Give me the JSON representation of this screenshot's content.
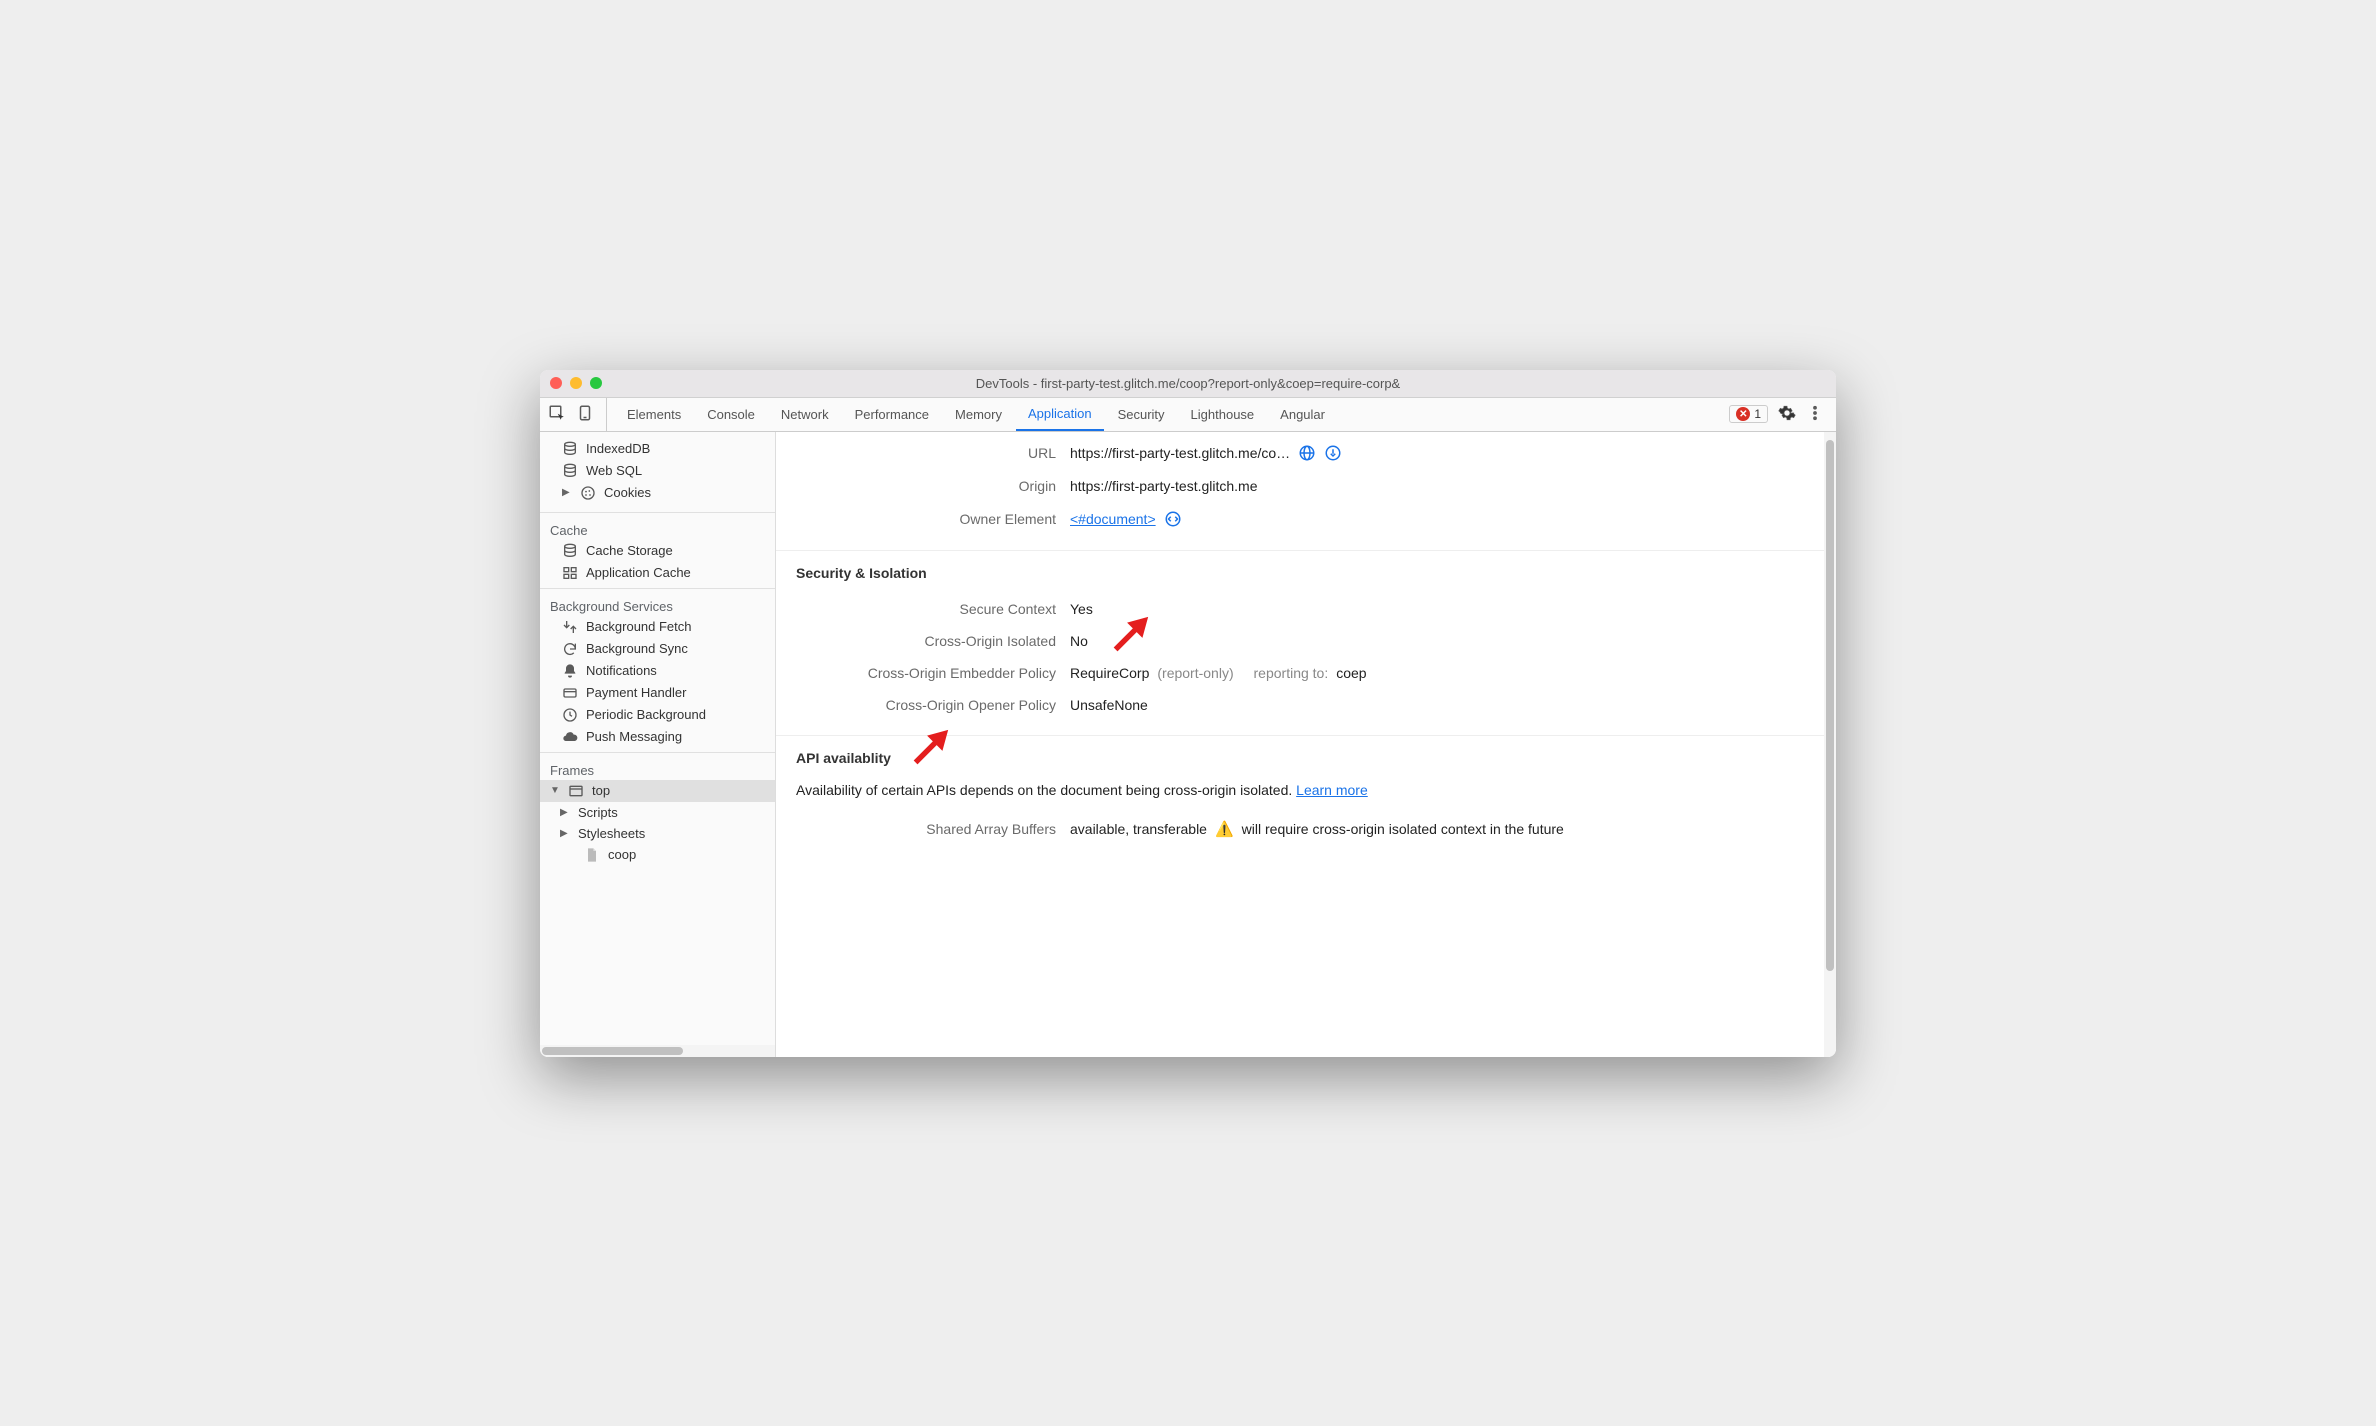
{
  "window": {
    "title": "DevTools - first-party-test.glitch.me/coop?report-only&coep=require-corp&"
  },
  "tabs": {
    "items": [
      "Elements",
      "Console",
      "Network",
      "Performance",
      "Memory",
      "Application",
      "Security",
      "Lighthouse",
      "Angular"
    ],
    "active": "Application",
    "error_count": "1"
  },
  "sidebar": {
    "indexeddb_label": "IndexedDB",
    "websql_label": "Web SQL",
    "cookies_label": "Cookies",
    "cache_heading": "Cache",
    "cache_storage_label": "Cache Storage",
    "app_cache_label": "Application Cache",
    "bg_heading": "Background Services",
    "bg_fetch_label": "Background Fetch",
    "bg_sync_label": "Background Sync",
    "notifications_label": "Notifications",
    "payment_label": "Payment Handler",
    "periodic_label": "Periodic Background",
    "push_label": "Push Messaging",
    "frames_heading": "Frames",
    "frame_top": "top",
    "frame_scripts": "Scripts",
    "frame_stylesheets": "Stylesheets",
    "frame_coop": "coop"
  },
  "details": {
    "url_label": "URL",
    "url_value": "https://first-party-test.glitch.me/co…",
    "origin_label": "Origin",
    "origin_value": "https://first-party-test.glitch.me",
    "owner_label": "Owner Element",
    "owner_value": "<#document>",
    "sec_heading": "Security & Isolation",
    "secure_ctx_label": "Secure Context",
    "secure_ctx_value": "Yes",
    "coi_label": "Cross-Origin Isolated",
    "coi_value": "No",
    "coep_label": "Cross-Origin Embedder Policy",
    "coep_value": "RequireCorp",
    "coep_report_only": "(report-only)",
    "coep_reporting_label": "reporting to:",
    "coep_reporting_value": "coep",
    "coop_label": "Cross-Origin Opener Policy",
    "coop_value": "UnsafeNone",
    "api_heading": "API availablity",
    "api_note_prefix": "Availability of certain APIs depends on the document being cross-origin isolated. ",
    "api_learn_more": "Learn more",
    "sab_label": "Shared Array Buffers",
    "sab_value": "available, transferable",
    "sab_warn_text": "will require cross-origin isolated context in the future"
  }
}
